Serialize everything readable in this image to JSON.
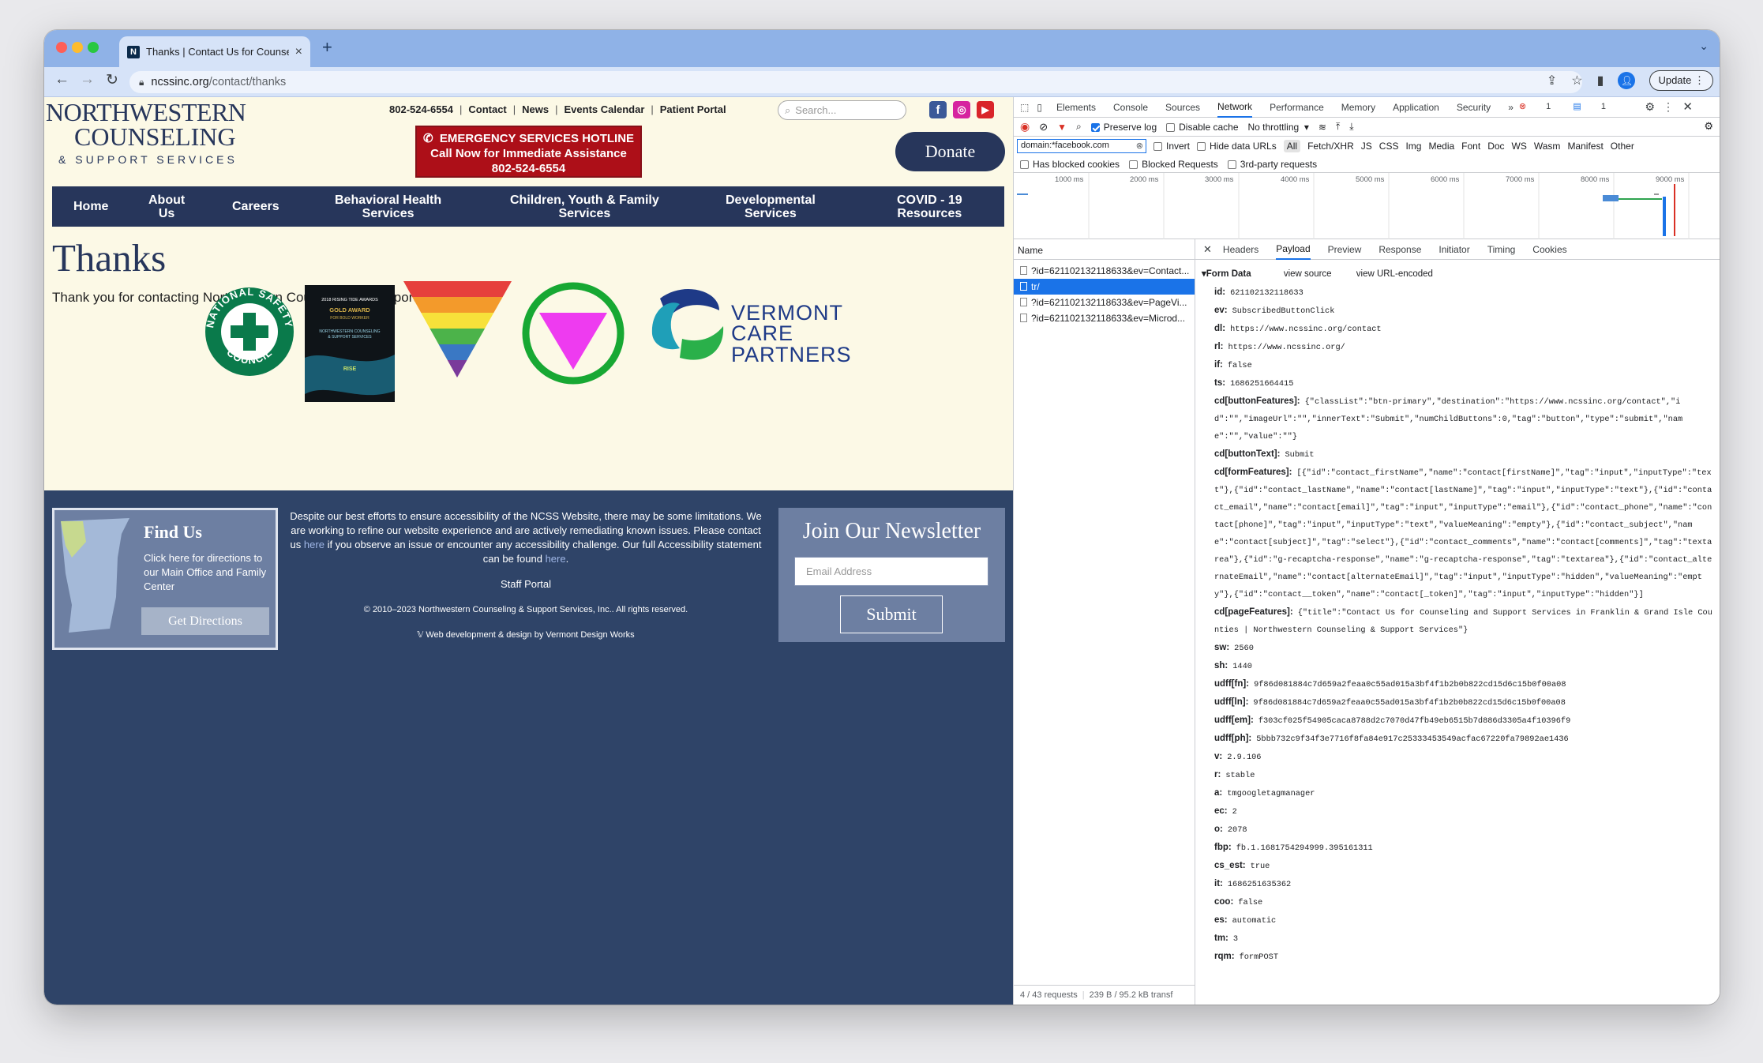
{
  "browser": {
    "tab_title": "Thanks | Contact Us for Counseling",
    "url_domain": "ncssinc.org",
    "url_path": "/contact/thanks",
    "update_label": "Update"
  },
  "site": {
    "logo": {
      "line1": "NORTHWESTERN",
      "line2": "COUNSELING",
      "line3": "& SUPPORT SERVICES"
    },
    "top_links": [
      "802-524-6554",
      "Contact",
      "News",
      "Events Calendar",
      "Patient Portal"
    ],
    "search_placeholder": "Search...",
    "hotline": {
      "line1": "EMERGENCY SERVICES HOTLINE",
      "line2": "Call Now for Immediate Assistance",
      "line3": "802-524-6554"
    },
    "donate_label": "Donate",
    "nav": [
      {
        "line1": "Home",
        "line2": ""
      },
      {
        "line1": "About",
        "line2": "Us"
      },
      {
        "line1": "Careers",
        "line2": ""
      },
      {
        "line1": "Behavioral Health",
        "line2": "Services"
      },
      {
        "line1": "Children, Youth & Family",
        "line2": "Services"
      },
      {
        "line1": "Developmental",
        "line2": "Services"
      },
      {
        "line1": "COVID - 19",
        "line2": "Resources"
      }
    ],
    "heading": "Thanks",
    "body_text": "Thank you for contacting Northwestern Counseling & Support Services",
    "badges": {
      "nsc": {
        "top": "NATIONAL SAFETY",
        "bottom": "COUNCIL"
      },
      "award": {
        "line1": "2018 RISING TIDE AWARDS",
        "line2": "GOLD AWARD",
        "line3": "FOR BOLD WORKER",
        "line4": "NORTHWESTERN COUNSELING",
        "line5": "& SUPPORT SERVICES",
        "brand": "RISE"
      },
      "vcp": {
        "line1": "VERMONT",
        "line2": "CARE",
        "line3": "PARTNERS"
      }
    },
    "footer": {
      "find_us_title": "Find Us",
      "find_us_text": "Click here for directions to our Main Office and Family Center",
      "get_directions": "Get Directions",
      "access_p1": "Despite our best efforts to ensure accessibility of the NCSS Website, there may be some limitations. We are working to refine our website experience and are actively remediating known issues. Please contact us",
      "access_link1": "here",
      "access_p2": "if you observe an issue or encounter any accessibility challenge. Our full Accessibility statement can be found",
      "access_link2": "here",
      "staff_portal": "Staff Portal",
      "copyright": "© 2010–2023 Northwestern Counseling & Support Services, Inc.. All rights reserved.",
      "credit": "Web development & design by Vermont Design Works",
      "newsletter_title": "Join Our Newsletter",
      "email_placeholder": "Email Address",
      "submit_label": "Submit"
    }
  },
  "devtools": {
    "tabs": [
      "Elements",
      "Console",
      "Sources",
      "Network",
      "Performance",
      "Memory",
      "Application",
      "Security"
    ],
    "active_tab": "Network",
    "errors": "1",
    "messages": "1",
    "preserve_log": "Preserve log",
    "disable_cache": "Disable cache",
    "throttling": "No throttling",
    "filter_value": "domain:*facebook.com",
    "invert": "Invert",
    "hide_data_urls": "Hide data URLs",
    "filter_types": [
      "All",
      "Fetch/XHR",
      "JS",
      "CSS",
      "Img",
      "Media",
      "Font",
      "Doc",
      "WS",
      "Wasm",
      "Manifest",
      "Other"
    ],
    "has_blocked_cookies": "Has blocked cookies",
    "blocked_requests": "Blocked Requests",
    "third_party": "3rd-party requests",
    "timeline_ticks": [
      "1000 ms",
      "2000 ms",
      "3000 ms",
      "4000 ms",
      "5000 ms",
      "6000 ms",
      "7000 ms",
      "8000 ms",
      "9000 ms"
    ],
    "name_header": "Name",
    "requests": [
      "?id=621102132118633&ev=Contact...",
      "tr/",
      "?id=621102132118633&ev=PageVi...",
      "?id=621102132118633&ev=Microd..."
    ],
    "selected_request": 1,
    "detail_tabs": [
      "Headers",
      "Payload",
      "Preview",
      "Response",
      "Initiator",
      "Timing",
      "Cookies"
    ],
    "active_detail_tab": "Payload",
    "form_data_title": "Form Data",
    "view_source": "view source",
    "view_url_encoded": "view URL-encoded",
    "fields": [
      {
        "k": "id:",
        "v": "621102132118633"
      },
      {
        "k": "ev:",
        "v": "SubscribedButtonClick"
      },
      {
        "k": "dl:",
        "v": "https://www.ncssinc.org/contact"
      },
      {
        "k": "rl:",
        "v": "https://www.ncssinc.org/"
      },
      {
        "k": "if:",
        "v": "false"
      },
      {
        "k": "ts:",
        "v": "1686251664415"
      },
      {
        "k": "cd[buttonFeatures]:",
        "v": "{\"classList\":\"btn-primary\",\"destination\":\"https://www.ncssinc.org/contact\",\"id\":\"\",\"imageUrl\":\"\",\"innerText\":\"Submit\",\"numChildButtons\":0,\"tag\":\"button\",\"type\":\"submit\",\"name\":\"\",\"value\":\"\"}"
      },
      {
        "k": "cd[buttonText]:",
        "v": "Submit"
      },
      {
        "k": "cd[formFeatures]:",
        "v": "[{\"id\":\"contact_firstName\",\"name\":\"contact[firstName]\",\"tag\":\"input\",\"inputType\":\"text\"},{\"id\":\"contact_lastName\",\"name\":\"contact[lastName]\",\"tag\":\"input\",\"inputType\":\"text\"},{\"id\":\"contact_email\",\"name\":\"contact[email]\",\"tag\":\"input\",\"inputType\":\"email\"},{\"id\":\"contact_phone\",\"name\":\"contact[phone]\",\"tag\":\"input\",\"inputType\":\"text\",\"valueMeaning\":\"empty\"},{\"id\":\"contact_subject\",\"name\":\"contact[subject]\",\"tag\":\"select\"},{\"id\":\"contact_comments\",\"name\":\"contact[comments]\",\"tag\":\"textarea\"},{\"id\":\"g-recaptcha-response\",\"name\":\"g-recaptcha-response\",\"tag\":\"textarea\"},{\"id\":\"contact_alternateEmail\",\"name\":\"contact[alternateEmail]\",\"tag\":\"input\",\"inputType\":\"hidden\",\"valueMeaning\":\"empty\"},{\"id\":\"contact__token\",\"name\":\"contact[_token]\",\"tag\":\"input\",\"inputType\":\"hidden\"}]"
      },
      {
        "k": "cd[pageFeatures]:",
        "v": "{\"title\":\"Contact Us for Counseling and Support Services in Franklin & Grand Isle Counties | Northwestern Counseling & Support Services\"}"
      },
      {
        "k": "sw:",
        "v": "2560"
      },
      {
        "k": "sh:",
        "v": "1440"
      },
      {
        "k": "udff[fn]:",
        "v": "9f86d081884c7d659a2feaa0c55ad015a3bf4f1b2b0b822cd15d6c15b0f00a08"
      },
      {
        "k": "udff[ln]:",
        "v": "9f86d081884c7d659a2feaa0c55ad015a3bf4f1b2b0b822cd15d6c15b0f00a08"
      },
      {
        "k": "udff[em]:",
        "v": "f303cf025f54905caca8788d2c7070d47fb49eb6515b7d886d3305a4f10396f9"
      },
      {
        "k": "udff[ph]:",
        "v": "5bbb732c9f34f3e7716f8fa84e917c25333453549acfac67220fa79892ae1436"
      },
      {
        "k": "v:",
        "v": "2.9.106"
      },
      {
        "k": "r:",
        "v": "stable"
      },
      {
        "k": "a:",
        "v": "tmgoogletagmanager"
      },
      {
        "k": "ec:",
        "v": "2"
      },
      {
        "k": "o:",
        "v": "2078"
      },
      {
        "k": "fbp:",
        "v": "fb.1.1681754294999.395161311"
      },
      {
        "k": "cs_est:",
        "v": "true"
      },
      {
        "k": "it:",
        "v": "1686251635362"
      },
      {
        "k": "coo:",
        "v": "false"
      },
      {
        "k": "es:",
        "v": "automatic"
      },
      {
        "k": "tm:",
        "v": "3"
      },
      {
        "k": "rqm:",
        "v": "formPOST"
      }
    ],
    "status_requests": "4 / 43 requests",
    "status_transferred": "239 B / 95.2 kB transf"
  },
  "colors": {
    "navy": "#27365b",
    "cream": "#fcf9e6",
    "hotline": "#ad0f18",
    "footer": "#2f4468",
    "devtools_accent": "#1a73e8"
  }
}
